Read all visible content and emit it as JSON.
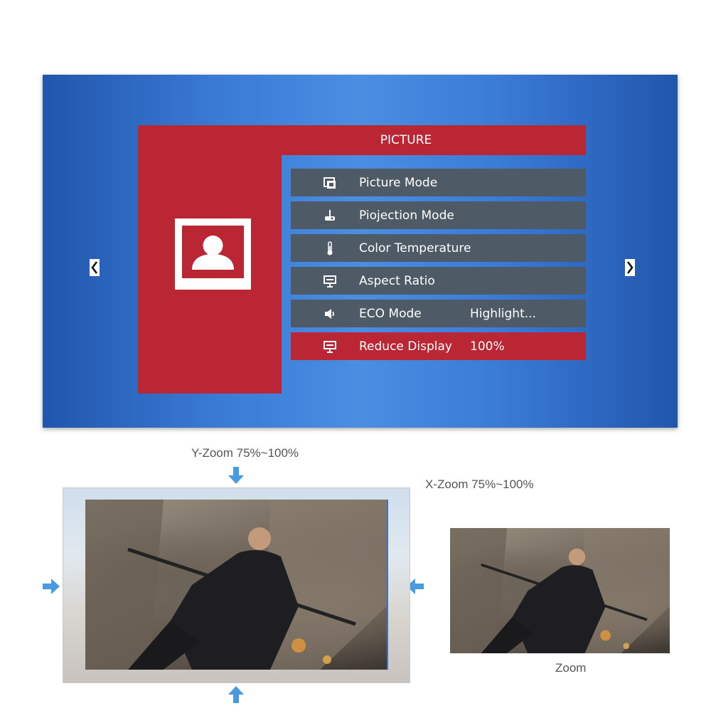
{
  "osd": {
    "header_title": "PICTURE",
    "items": [
      {
        "label": "Picture Mode",
        "value": "",
        "icon": "picture-mode-icon",
        "selected": false
      },
      {
        "label": "Piojection Mode",
        "value": "",
        "icon": "projector-icon",
        "selected": false
      },
      {
        "label": "Color Temperature",
        "value": "",
        "icon": "thermometer-icon",
        "selected": false
      },
      {
        "label": "Aspect Ratio",
        "value": "",
        "icon": "monitor-icon",
        "selected": false
      },
      {
        "label": "ECO Mode",
        "value": "Highlight...",
        "icon": "speaker-icon",
        "selected": false
      },
      {
        "label": "Reduce Display",
        "value": "100%",
        "icon": "monitor-icon",
        "selected": true
      }
    ],
    "nav_left_icon": "chevron-left-icon",
    "nav_right_icon": "chevron-right-icon"
  },
  "captions": {
    "y_zoom": "Y-Zoom 75%~100%",
    "x_zoom": "X-Zoom 75%~100%",
    "zoom": "Zoom"
  },
  "colors": {
    "menu_red": "#bb2635",
    "menu_item_gray": "#4e5a66",
    "screen_blue": "#3a7bd6",
    "arrow_blue": "#4a9ae0"
  }
}
